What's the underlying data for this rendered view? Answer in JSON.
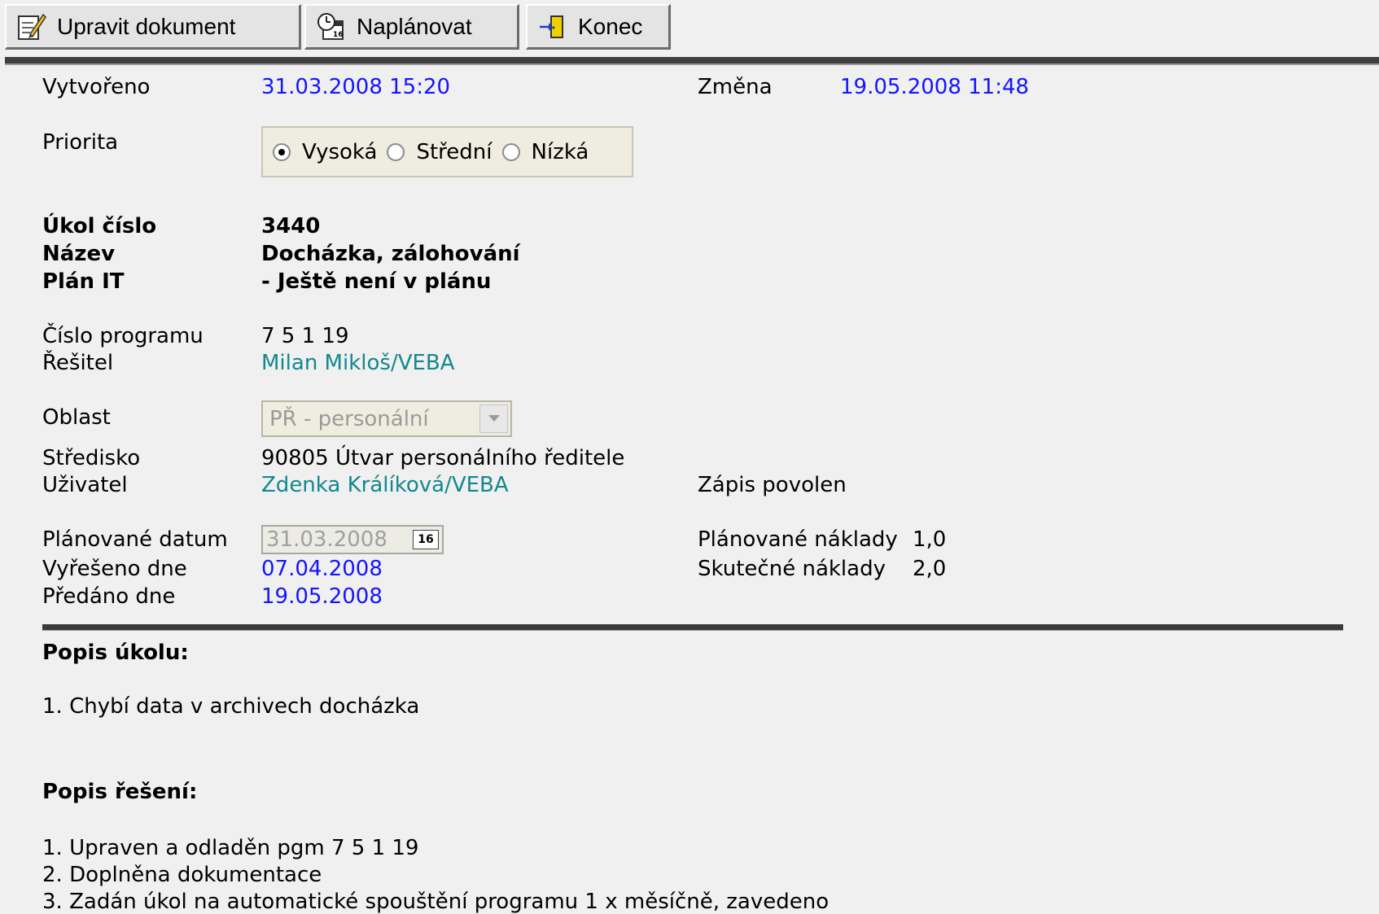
{
  "toolbar": {
    "edit_label": "Upravit dokument",
    "schedule_label": "Naplánovat",
    "exit_label": "Konec"
  },
  "meta": {
    "created_label": "Vytvořeno",
    "created_value": "31.03.2008 15:20",
    "changed_label": "Změna",
    "changed_value": "19.05.2008 11:48"
  },
  "priority": {
    "label": "Priorita",
    "options": [
      "Vysoká",
      "Střední",
      "Nízká"
    ],
    "selected": "Vysoká"
  },
  "task": {
    "number_label": "Úkol číslo",
    "number_value": "3440",
    "name_label": "Název",
    "name_value": "Docházka, zálohování",
    "plan_label": "Plán IT",
    "plan_value": "- Ještě není v plánu"
  },
  "program": {
    "number_label": "Číslo programu",
    "number_value": "7 5 1 19",
    "solver_label": "Řešitel",
    "solver_value": "Milan Mikloš/VEBA"
  },
  "area": {
    "label": "Oblast",
    "value": "PŘ - personální"
  },
  "center": {
    "label": "Středisko",
    "value": "90805 Útvar personálního ředitele"
  },
  "user": {
    "label": "Uživatel",
    "value": "Zdenka Králíková/VEBA",
    "write_permission": "Zápis povolen"
  },
  "dates": {
    "planned_label": "Plánované datum",
    "planned_value": "31.03.2008",
    "calendar_day": "16",
    "resolved_label": "Vyřešeno dne",
    "resolved_value": "07.04.2008",
    "handed_label": "Předáno dne",
    "handed_value": "19.05.2008"
  },
  "costs": {
    "planned_label": "Plánované náklady",
    "planned_value": "1,0",
    "actual_label": "Skutečné náklady",
    "actual_value": "2,0"
  },
  "description": {
    "heading": "Popis úkolu:",
    "lines": [
      "1. Chybí data v archivech docházka"
    ]
  },
  "solution": {
    "heading": "Popis řešení:",
    "lines": [
      "1. Upraven a odladěn pgm 7 5 1 19",
      "2. Doplněna dokumentace",
      "3. Zadán úkol na automatické spouštění programu 1 x měsíčně, zavedeno"
    ]
  }
}
